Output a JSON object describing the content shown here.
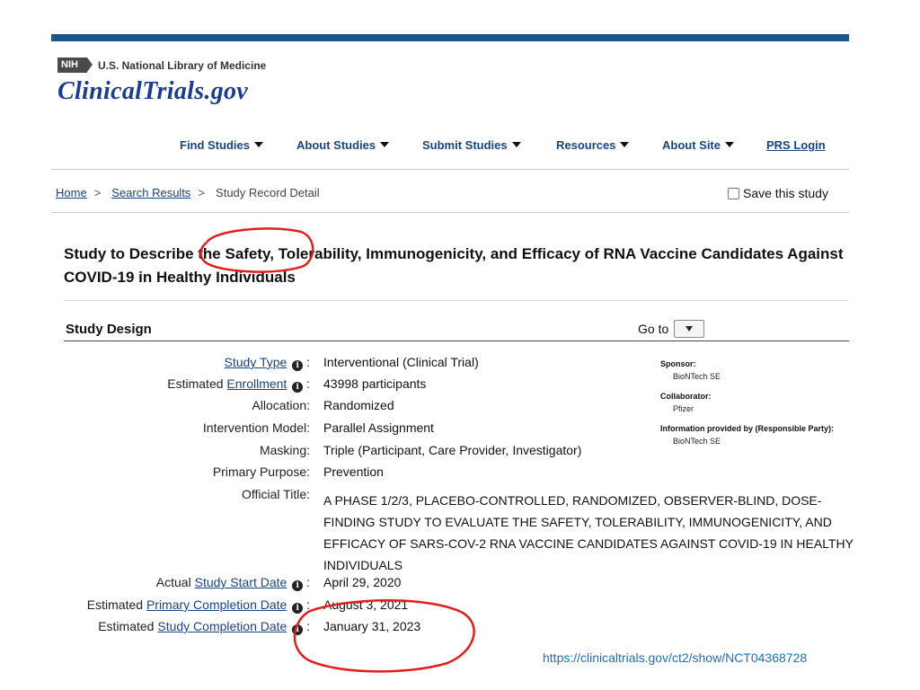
{
  "header": {
    "nih_badge": "NIH",
    "library": "U.S. National Library of Medicine",
    "brand": "ClinicalTrials.gov"
  },
  "nav": {
    "items": [
      "Find Studies",
      "About Studies",
      "Submit Studies",
      "Resources",
      "About Site"
    ],
    "login": "PRS Login"
  },
  "breadcrumb": {
    "home": "Home",
    "sep": ">",
    "search_results": "Search Results",
    "current": "Study Record Detail"
  },
  "save_label": "Save this study",
  "study": {
    "title": "Study to Describe the Safety, Tolerability, Immunogenicity, and Efficacy of RNA Vaccine Candidates Against COVID-19 in Healthy Individuals"
  },
  "section": {
    "heading": "Study Design",
    "goto_label": "Go to"
  },
  "design": {
    "study_type_link": "Study Type",
    "study_type": "Interventional  (Clinical Trial)",
    "enrollment_prefix": "Estimated",
    "enrollment_link": "Enrollment",
    "enrollment": "43998 participants",
    "allocation_label": "Allocation:",
    "allocation": "Randomized",
    "model_label": "Intervention Model:",
    "model": "Parallel Assignment",
    "masking_label": "Masking:",
    "masking": "Triple (Participant, Care Provider, Investigator)",
    "purpose_label": "Primary Purpose:",
    "purpose": "Prevention",
    "official_label": "Official Title:",
    "official": "A PHASE 1/2/3, PLACEBO-CONTROLLED, RANDOMIZED, OBSERVER-BLIND, DOSE-FINDING STUDY TO EVALUATE THE SAFETY, TOLERABILITY, IMMUNOGENICITY, AND EFFICACY OF SARS-COV-2 RNA VACCINE CANDIDATES AGAINST COVID-19 IN HEALTHY INDIVIDUALS",
    "start_prefix": "Actual",
    "start_link": "Study Start Date",
    "start": "April 29, 2020",
    "primary_prefix": "Estimated",
    "primary_link": "Primary Completion Date",
    "primary": "August 3, 2021",
    "completion_prefix": "Estimated",
    "completion_link": "Study Completion Date",
    "completion": "January 31, 2023"
  },
  "sidebar": {
    "sponsor_label": "Sponsor:",
    "sponsor": "BioNTech SE",
    "collaborator_label": "Collaborator:",
    "collaborator": "Pfizer",
    "info_label": "Information provided by (Responsible Party):",
    "info": "BioNTech SE"
  },
  "source_url": "https://clinicaltrials.gov/ct2/show/NCT04368728",
  "colors": {
    "topbar": "#20558a",
    "brand": "#1a3d8c",
    "link": "#1a4480",
    "annotation": "#e0201b"
  },
  "icons": {
    "info": "info-circle-icon",
    "caret": "caret-down-icon"
  }
}
